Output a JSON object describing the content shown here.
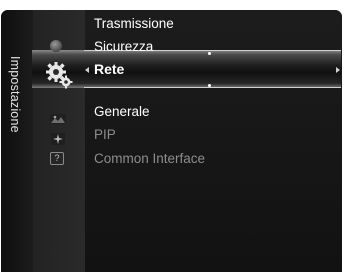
{
  "sidebar": {
    "title": "Impostazione"
  },
  "menu": {
    "items": [
      {
        "label": "Trasmissione",
        "state": "normal"
      },
      {
        "label": "Sicurezza",
        "state": "normal"
      },
      {
        "label": "Rete",
        "state": "selected"
      },
      {
        "label": "Generale",
        "state": "normal"
      },
      {
        "label": "PIP",
        "state": "disabled"
      },
      {
        "label": "Common Interface",
        "state": "disabled"
      }
    ]
  },
  "icons": {
    "disc": "disc-icon",
    "settings": "gear-icon",
    "picture": "picture-icon",
    "sparkle": "sparkle-icon",
    "help": "help-icon"
  },
  "colors": {
    "panel": "#1a1a1a",
    "text": "#ffffff",
    "disabled_text": "#8d8d8d"
  }
}
